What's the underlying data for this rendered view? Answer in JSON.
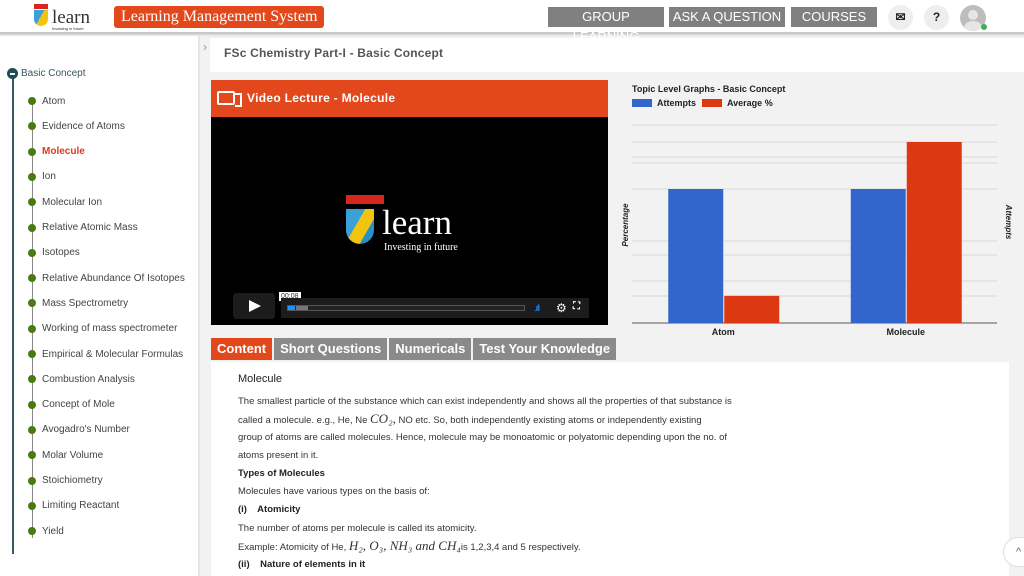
{
  "header": {
    "logo_text": "learn",
    "logo_tagline": "Investing in future",
    "app_title": "Learning Management System",
    "nav": [
      "GROUP LEARNING",
      "ASK A QUESTION",
      "COURSES"
    ],
    "mail_icon": "mail-icon",
    "help_label": "?",
    "online_color": "#3cb054"
  },
  "sidebar": {
    "root": "Basic Concept",
    "items": [
      {
        "label": "Atom",
        "active": false
      },
      {
        "label": "Evidence of Atoms",
        "active": false
      },
      {
        "label": "Molecule",
        "active": true
      },
      {
        "label": "Ion",
        "active": false
      },
      {
        "label": "Molecular Ion",
        "active": false
      },
      {
        "label": "Relative Atomic Mass",
        "active": false
      },
      {
        "label": "Isotopes",
        "active": false
      },
      {
        "label": "Relative Abundance Of Isotopes",
        "active": false
      },
      {
        "label": "Mass Spectrometry",
        "active": false
      },
      {
        "label": "Working of mass spectrometer",
        "active": false
      },
      {
        "label": "Empirical & Molecular Formulas",
        "active": false
      },
      {
        "label": "Combustion Analysis",
        "active": false
      },
      {
        "label": "Concept of Mole",
        "active": false
      },
      {
        "label": "Avogadro's Number",
        "active": false
      },
      {
        "label": "Molar Volume",
        "active": false
      },
      {
        "label": "Stoichiometry",
        "active": false
      },
      {
        "label": "Limiting Reactant",
        "active": false
      },
      {
        "label": "Yield",
        "active": false
      }
    ]
  },
  "breadcrumb": "FSc Chemistry Part-I - Basic Concept",
  "video": {
    "title": "Video Lecture - Molecule",
    "logo_text": "learn",
    "logo_tagline": "Investing in future",
    "time": "00:08",
    "progress": 0.03
  },
  "tabs": [
    "Content",
    "Short Questions",
    "Numericals",
    "Test Your Knowledge"
  ],
  "content": {
    "heading": "Molecule",
    "lines": [
      "The smallest particle of the substance which can exist independently and shows all the properties of that substance is",
      "called a molecule. e.g., He, Ne",
      "NO etc. So, both independently existing atoms or independently existing",
      "group of atoms are called molecules. Hence, molecule may be monoatomic or polyatomic depending upon the no. of",
      "atoms present in it."
    ],
    "formula_co2": "CO₂,",
    "types_heading": "Types of Molecules",
    "types_intro": "Molecules have various types on the basis of:",
    "atomicity_heading": "(i)    Atomicity",
    "atomicity_def": "The number of atoms per molecule is called its atomicity.",
    "example_prefix": "Example: Atomicity of He,",
    "example_formula": "H₂, O₃, NH₃ and CH₄",
    "example_suffix": "is 1,2,3,4 and 5 respectively.",
    "nature_heading": "(ii)    Nature of elements in it"
  },
  "chart_data": {
    "type": "bar",
    "title": "Topic Level Graphs - Basic Concept",
    "categories": [
      "Atom",
      "Molecule"
    ],
    "series": [
      {
        "name": "Attempts",
        "color": "#3366cc",
        "values": [
          1,
          1
        ]
      },
      {
        "name": "Average %",
        "color": "#dc3912",
        "values": [
          15,
          100
        ]
      }
    ],
    "ylabel_left": "Percentage",
    "ylabel_right": "Attempts",
    "legend": "top-left",
    "grid": true
  }
}
